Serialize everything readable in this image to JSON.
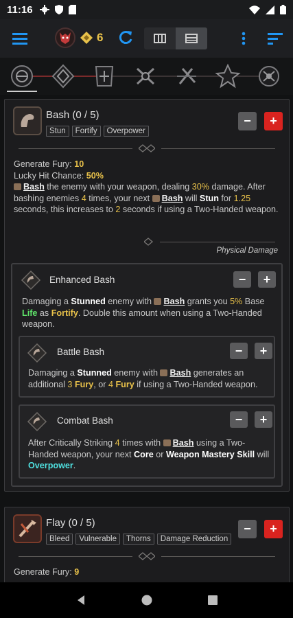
{
  "status": {
    "time": "11:16"
  },
  "toolbar": {
    "points": "6"
  },
  "skills": [
    {
      "title": "Bash (0 / 5)",
      "tags": [
        "Stun",
        "Fortify",
        "Overpower"
      ],
      "stat1_label": "Generate Fury:",
      "stat1_value": "10",
      "stat2_label": "Lucky Hit Chance:",
      "stat2_value": "50%",
      "desc": {
        "w1": "Bash",
        "t1": " the enemy with your weapon, dealing ",
        "v1": "30%",
        "t2": " damage. After bashing enemies ",
        "v2": "4",
        "t3": " times, your next ",
        "w2": "Bash",
        "t4": " will ",
        "w3": "Stun",
        "t5": " for ",
        "v3": "1.25",
        "t6": " seconds, this increases to ",
        "v4": "2",
        "t7": " seconds if using a Two-Handed weapon."
      },
      "damage_type": "Physical Damage",
      "enhancement": {
        "title": "Enhanced Bash",
        "d1": "Damaging a ",
        "k1": "Stunned",
        "d2": " enemy with ",
        "k2": "Bash",
        "d3": " grants you ",
        "v1": "5%",
        "d4": " Base ",
        "k3": "Life",
        "d5": " as ",
        "k4": "Fortify",
        "d6": ". Double this amount when using a Two-Handed weapon."
      },
      "upgrades": [
        {
          "title": "Battle Bash",
          "d1": "Damaging a ",
          "k1": "Stunned",
          "d2": " enemy with ",
          "k2": "Bash",
          "d3": " generates an additional ",
          "v1": "3",
          "k3": "Fury",
          "d4": ", or ",
          "v2": "4",
          "k4": "Fury",
          "d5": " if using a Two-Handed weapon."
        },
        {
          "title": "Combat Bash",
          "d1": "After Critically Striking ",
          "v1": "4",
          "d2": " times with ",
          "k1": "Bash",
          "d3": " using a Two-Handed weapon, your next ",
          "k2": "Core",
          "d4": " or ",
          "k3": "Weapon Mastery Skill",
          "d5": " will ",
          "k4": "Overpower",
          "d6": "."
        }
      ]
    },
    {
      "title": "Flay (0 / 5)",
      "tags": [
        "Bleed",
        "Vulnerable",
        "Thorns",
        "Damage Reduction"
      ],
      "stat1_label": "Generate Fury:",
      "stat1_value": "9"
    }
  ],
  "colors": {
    "accent": "#2196f3",
    "gold": "#e8c14a",
    "red_button": "#d9231f",
    "cyan": "#4fe0e0"
  }
}
